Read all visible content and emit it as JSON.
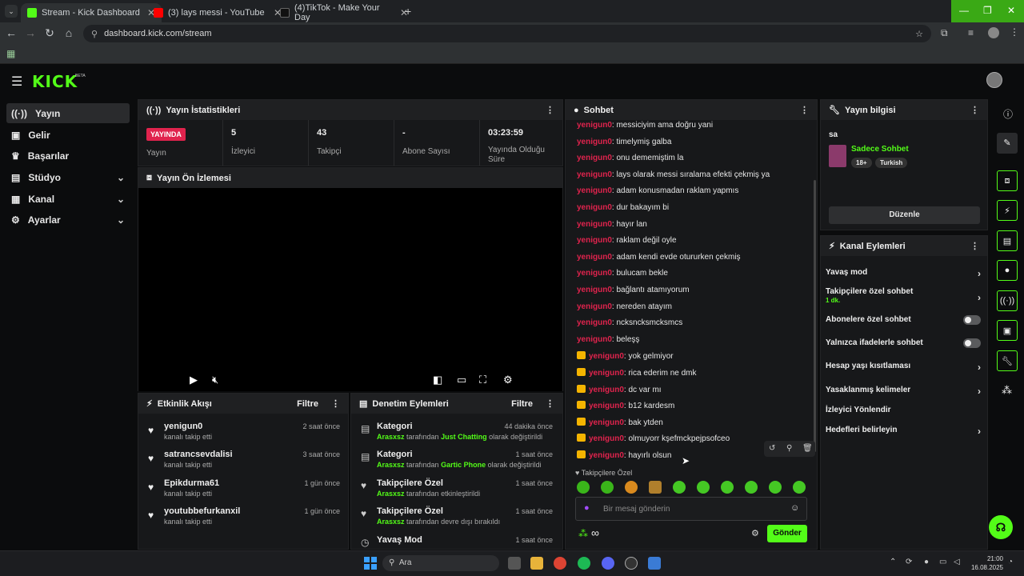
{
  "browser": {
    "tabs": [
      {
        "title": "Stream - Kick Dashboard",
        "color": "#53fc18"
      },
      {
        "title": "(3) lays messi - YouTube",
        "color": "#ff0000"
      },
      {
        "title": "(4)TikTok - Make Your Day",
        "color": "#222222"
      }
    ],
    "url": "dashboard.kick.com/stream"
  },
  "brand": {
    "logo": "KICK",
    "beta": "BETA",
    "accent": "#53fc18"
  },
  "sidebar": {
    "items": [
      {
        "label": "Yayın",
        "icon": "broadcast-icon"
      },
      {
        "label": "Gelir",
        "icon": "wallet-icon"
      },
      {
        "label": "Başarılar",
        "icon": "trophy-icon"
      },
      {
        "label": "Stüdyo",
        "icon": "studio-icon"
      },
      {
        "label": "Kanal",
        "icon": "channel-icon"
      },
      {
        "label": "Ayarlar",
        "icon": "gear-icon"
      }
    ]
  },
  "stats": {
    "title": "Yayın İstatistikleri",
    "live_badge": "YAYINDA",
    "items": [
      {
        "value": "",
        "label": "Yayın"
      },
      {
        "value": "5",
        "label": "İzleyici"
      },
      {
        "value": "43",
        "label": "Takipçi"
      },
      {
        "value": "-",
        "label": "Abone Sayısı"
      },
      {
        "value": "03:23:59",
        "label": "Yayında Olduğu Süre"
      }
    ]
  },
  "preview": {
    "title": "Yayın Ön İzlemesi"
  },
  "activity": {
    "title": "Etkinlik Akışı",
    "filter": "Filtre",
    "rows": [
      {
        "name": "yenigun0",
        "sub": "kanalı takip etti",
        "time": "2 saat önce"
      },
      {
        "name": "satrancsevdalisi",
        "sub": "kanalı takip etti",
        "time": "3 saat önce"
      },
      {
        "name": "Epikdurma61",
        "sub": "kanalı takip etti",
        "time": "1 gün önce"
      },
      {
        "name": "youtubbefurkanxil",
        "sub": "kanalı takip etti",
        "time": "1 gün önce"
      }
    ]
  },
  "moderation": {
    "title": "Denetim Eylemleri",
    "filter": "Filtre",
    "rows": [
      {
        "name": "Kategori",
        "actor": "Arasxsz",
        "mid": " tarafından ",
        "hl": "Just Chatting",
        "end": " olarak değiştirildi",
        "time": "44 dakika önce"
      },
      {
        "name": "Kategori",
        "actor": "Arasxsz",
        "mid": " tarafından ",
        "hl": "Gartic Phone",
        "end": " olarak değiştirildi",
        "time": "1 saat önce"
      },
      {
        "name": "Takipçilere Özel",
        "actor": "Arasxsz",
        "mid": " tarafından etkinleştirildi",
        "hl": "",
        "end": "",
        "time": "1 saat önce"
      },
      {
        "name": "Takipçilere Özel",
        "actor": "Arasxsz",
        "mid": " tarafından devre dışı bırakıldı",
        "hl": "",
        "end": "",
        "time": "1 saat önce"
      },
      {
        "name": "Yavaş Mod",
        "actor": "",
        "mid": "",
        "hl": "",
        "end": "",
        "time": "1 saat önce"
      }
    ]
  },
  "chat": {
    "title": "Sohbet",
    "messages": [
      {
        "user": "yenigun0",
        "text": "messiciyim ama doğru yani",
        "crown": false
      },
      {
        "user": "yenigun0",
        "text": "timelymiş galba",
        "crown": false
      },
      {
        "user": "yenigun0",
        "text": "onu dememiştim la",
        "crown": false
      },
      {
        "user": "yenigun0",
        "text": "lays olarak messi sıralama efekti çekmiş ya",
        "crown": false
      },
      {
        "user": "yenigun0",
        "text": "adam konusmadan raklam yapmıs",
        "crown": false
      },
      {
        "user": "yenigun0",
        "text": "dur bakayım bi",
        "crown": false
      },
      {
        "user": "yenigun0",
        "text": "hayır lan",
        "crown": false
      },
      {
        "user": "yenigun0",
        "text": "raklam değil oyle",
        "crown": false
      },
      {
        "user": "yenigun0",
        "text": "adam kendi evde otururken çekmiş",
        "crown": false
      },
      {
        "user": "yenigun0",
        "text": "bulucam bekle",
        "crown": false
      },
      {
        "user": "yenigun0",
        "text": "bağlantı atamıyorum",
        "crown": false
      },
      {
        "user": "yenigun0",
        "text": "nereden atayım",
        "crown": false
      },
      {
        "user": "yenigun0",
        "text": "ncksncksmcksmcs",
        "crown": false
      },
      {
        "user": "yenigun0",
        "text": "beleşş",
        "crown": false
      },
      {
        "user": "yenigun0",
        "text": "yok gelmiyor",
        "crown": true
      },
      {
        "user": "yenigun0",
        "text": "rica ederim ne dmk",
        "crown": true
      },
      {
        "user": "yenigun0",
        "text": "dc var mı",
        "crown": true
      },
      {
        "user": "yenigun0",
        "text": "b12 kardesm",
        "crown": true
      },
      {
        "user": "yenigun0",
        "text": "bak ytden",
        "crown": true
      },
      {
        "user": "yenigun0",
        "text": "olmuyorr kşefmckpejpsofceo",
        "crown": true
      },
      {
        "user": "yenigun0",
        "text": "hayırlı olsun",
        "crown": true
      }
    ],
    "followers_only": "Takipçilere Özel",
    "placeholder": "Bir mesaj gönderin",
    "send": "Gönder",
    "infinity": "∞"
  },
  "stream_info": {
    "title": "Yayın bilgisi",
    "stream_title": "sa",
    "category": "Sadece Sohbet",
    "tags": [
      "18+",
      "Turkish"
    ],
    "edit": "Düzenle"
  },
  "channel_actions": {
    "title": "Kanal Eylemleri",
    "slow_mode": "Yavaş mod",
    "followers_chat": "Takipçilere özel sohbet",
    "followers_chat_value": "1 dk.",
    "subs_chat": "Abonelere özel sohbet",
    "emote_chat": "Yalnızca ifadelerle sohbet",
    "account_age": "Hesap yaşı kısıtlaması",
    "banned_words": "Yasaklanmış kelimeler",
    "redirect": "İzleyici Yönlendir",
    "targets": "Hedefleri belirleyin"
  },
  "taskbar": {
    "search": "Ara",
    "time": "21:00",
    "date": "16.08.2025"
  }
}
